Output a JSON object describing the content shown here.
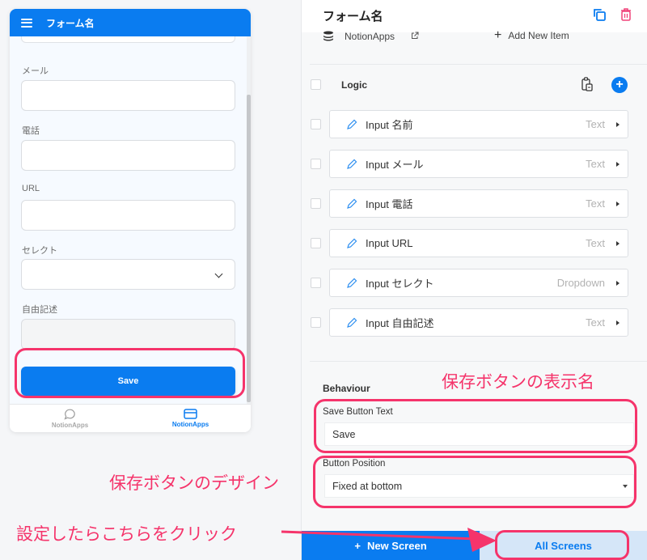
{
  "preview": {
    "title": "フォーム名",
    "fields": [
      {
        "label": "メール",
        "value": "",
        "type": "text"
      },
      {
        "label": "電話",
        "value": "",
        "type": "text"
      },
      {
        "label": "URL",
        "value": "",
        "type": "text"
      },
      {
        "label": "セレクト",
        "value": "",
        "type": "select"
      },
      {
        "label": "自由記述",
        "value": "",
        "type": "textarea"
      }
    ],
    "save_label": "Save",
    "tabs": [
      {
        "label": "NotionApps",
        "icon": "chat-bubble-icon",
        "active": false
      },
      {
        "label": "NotionApps",
        "icon": "card-icon",
        "active": true
      }
    ]
  },
  "editor": {
    "title": "フォーム名",
    "data_source": "NotionApps",
    "add_item_label": "Add New Item",
    "logic_label": "Logic",
    "components": [
      {
        "name": "Input 名前",
        "type": "Text"
      },
      {
        "name": "Input メール",
        "type": "Text"
      },
      {
        "name": "Input 電話",
        "type": "Text"
      },
      {
        "name": "Input URL",
        "type": "Text"
      },
      {
        "name": "Input セレクト",
        "type": "Dropdown"
      },
      {
        "name": "Input 自由記述",
        "type": "Text"
      }
    ],
    "behaviour_label": "Behaviour",
    "save_button_text_label": "Save Button Text",
    "save_button_text_value": "Save",
    "button_position_label": "Button Position",
    "button_position_value": "Fixed at bottom",
    "new_screen_label": "New Screen",
    "all_screens_label": "All Screens"
  },
  "annotations": {
    "save_label_note": "保存ボタンの表示名",
    "design_note": "保存ボタンのデザイン",
    "click_note": "設定したらこちらをクリック"
  },
  "colors": {
    "primary": "#0a7cf0",
    "annotation": "#f5346b",
    "danger": "#f0437a"
  }
}
